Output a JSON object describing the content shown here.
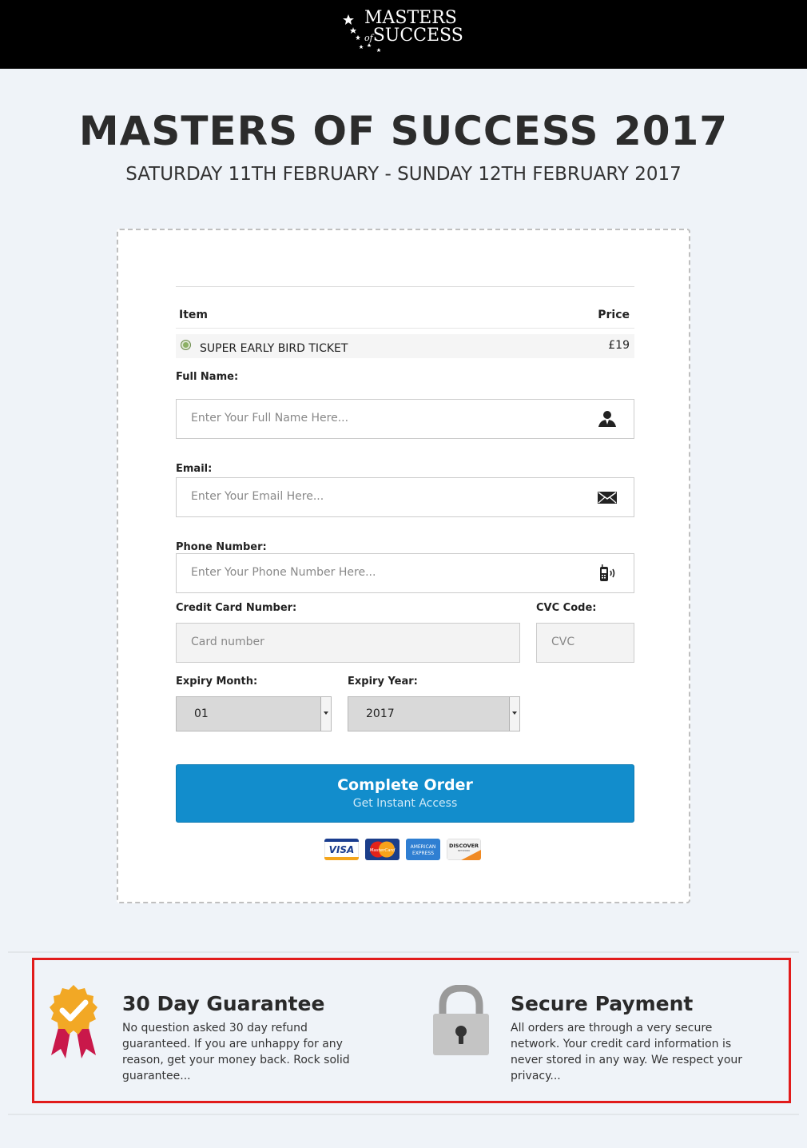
{
  "header": {
    "logo_line1": "MASTERS",
    "logo_of": "of",
    "logo_line2": "SUCCESS"
  },
  "hero": {
    "title": "MASTERS OF SUCCESS 2017",
    "subtitle": "SATURDAY 11TH FEBRUARY - SUNDAY 12TH FEBRUARY 2017"
  },
  "order": {
    "col_item": "Item",
    "col_price": "Price",
    "item_name": "SUPER EARLY BIRD TICKET",
    "item_price": "£19"
  },
  "form": {
    "full_name_label": "Full Name:",
    "full_name_placeholder": "Enter Your Full Name Here...",
    "email_label": "Email:",
    "email_placeholder": "Enter Your Email Here...",
    "phone_label": "Phone Number:",
    "phone_placeholder": "Enter Your Phone Number Here...",
    "card_label": "Credit Card Number:",
    "card_placeholder": "Card number",
    "cvc_label": "CVC Code:",
    "cvc_placeholder": "CVC",
    "expiry_month_label": "Expiry Month:",
    "expiry_month_value": "01",
    "expiry_year_label": "Expiry Year:",
    "expiry_year_value": "2017"
  },
  "submit": {
    "label": "Complete Order",
    "sublabel": "Get Instant Access"
  },
  "payment_logos": {
    "visa": "VISA",
    "mastercard": "MasterCard",
    "amex_line1": "AMERICAN",
    "amex_line2": "EXPRESS",
    "discover": "DISCOVER",
    "discover_sub": "NETWORK"
  },
  "guarantee": {
    "title": "30 Day Guarantee",
    "text": "No question asked 30 day refund guaranteed. If you are unhappy for any reason, get your money back. Rock solid guarantee..."
  },
  "secure": {
    "title": "Secure Payment",
    "text": "All orders are through a very secure network. Your credit card information is never stored in any way. We respect your privacy..."
  },
  "colors": {
    "button": "#128dcc",
    "highlight_border": "#e11b1b",
    "page_bg": "#eff3f8"
  }
}
